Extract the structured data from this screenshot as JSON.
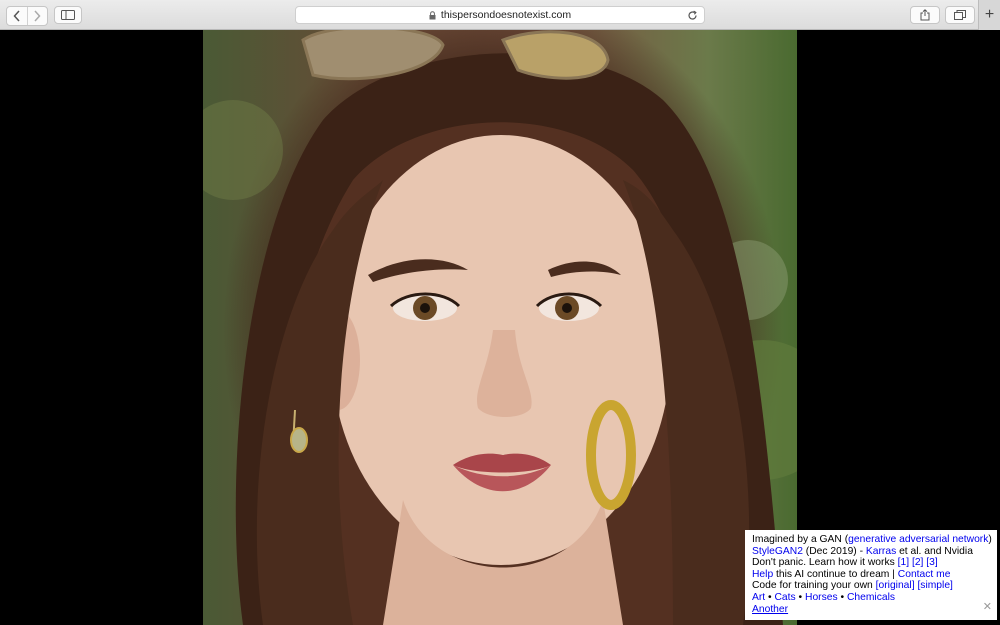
{
  "browser": {
    "url": "thispersondoesnotexist.com",
    "icons": [
      "back-icon",
      "forward-icon",
      "sidebar-icon",
      "lock-icon",
      "reload-icon",
      "share-icon",
      "tabs-icon",
      "plus-icon"
    ]
  },
  "info": {
    "l1_text": "Imagined by a GAN (",
    "l1_link": "generative adversarial network",
    "l1_end": ")",
    "l2_link": "StyleGAN2",
    "l2_mid": " (Dec 2019) - ",
    "l2_link2": "Karras",
    "l2_end": " et al. and Nvidia",
    "l3_text": "Don't panic. Learn how it works ",
    "l3_ref1": "[1]",
    "l3_ref2": "[2]",
    "l3_ref3": "[3]",
    "l4_link": "Help",
    "l4_mid": " this AI continue to dream | ",
    "l4_link2": "Contact me",
    "l5_text": "Code for training your own ",
    "l5_link1": "[original]",
    "l5_link2": "[simple]",
    "l6_art": "Art",
    "l6_cats": "Cats",
    "l6_horses": "Horses",
    "l6_chem": "Chemicals",
    "sep": " • ",
    "l7_link": "Another",
    "close": "✕"
  }
}
